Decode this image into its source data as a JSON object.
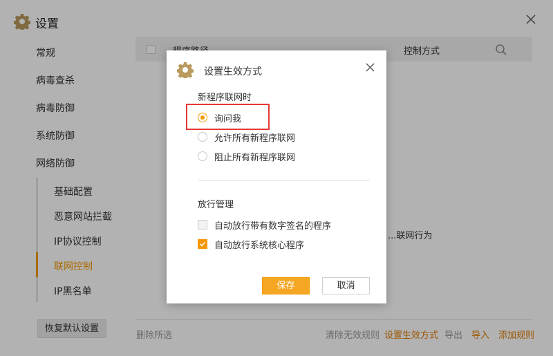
{
  "window": {
    "title": "设置",
    "title_icon": "gear-icon",
    "close_icon": "close-icon"
  },
  "sidebar": {
    "items": [
      {
        "label": "常规"
      },
      {
        "label": "病毒查杀"
      },
      {
        "label": "病毒防御"
      },
      {
        "label": "系统防御"
      },
      {
        "label": "网络防御"
      }
    ],
    "sub_items": [
      {
        "label": "基础配置",
        "active": false
      },
      {
        "label": "恶意网站拦截",
        "active": false
      },
      {
        "label": "IP协议控制",
        "active": false
      },
      {
        "label": "联网控制",
        "active": true
      },
      {
        "label": "IP黑名单",
        "active": false
      }
    ],
    "restore_label": "恢复默认设置"
  },
  "table": {
    "col_path": "程序路径",
    "col_control": "控制方式",
    "search_icon": "search-icon",
    "empty_hint": "...联网行为"
  },
  "footer": {
    "delete_selected": "删除所选",
    "clear_invalid": "清除无效规则",
    "set_effective": "设置生效方式",
    "export": "导出",
    "import": "导入",
    "add_rule": "添加规则"
  },
  "dialog": {
    "title": "设置生效方式",
    "section_network": "新程序联网时",
    "radio_options": [
      {
        "label": "询问我",
        "checked": true
      },
      {
        "label": "允许所有新程序联网",
        "checked": false
      },
      {
        "label": "阻止所有新程序联网",
        "checked": false
      }
    ],
    "section_release": "放行管理",
    "check_options": [
      {
        "label": "自动放行带有数字签名的程序",
        "checked": false
      },
      {
        "label": "自动放行系统核心程序",
        "checked": true
      }
    ],
    "save_label": "保存",
    "cancel_label": "取消"
  },
  "colors": {
    "accent": "#f39800",
    "highlight": "#e53935",
    "gear": "#b89a5e"
  }
}
